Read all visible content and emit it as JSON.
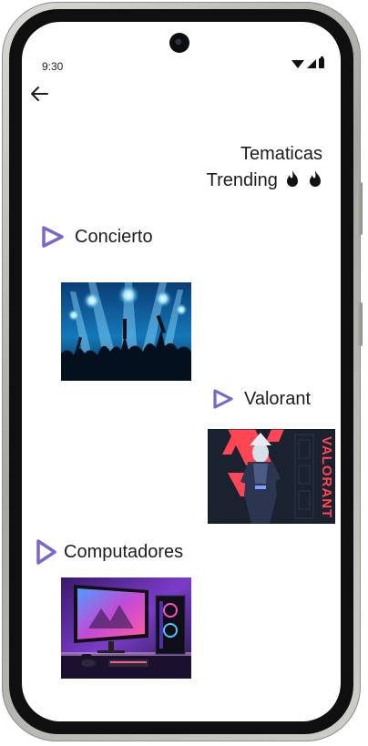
{
  "status_bar": {
    "time": "9:30",
    "icons": [
      "wifi-icon",
      "signal-icon",
      "battery-icon"
    ]
  },
  "header": {
    "back_icon": "arrow-left-icon",
    "title_line1": "Tematicas",
    "title_line2": "Trending",
    "title_icons": [
      "fire-icon",
      "fire-icon"
    ]
  },
  "topics": [
    {
      "label": "Concierto",
      "image": "concert-crowd-stage-lights-image"
    },
    {
      "label": "Valorant",
      "image": "valorant-agent-poster-image"
    },
    {
      "label": "Computadores",
      "image": "gaming-pc-desk-setup-image"
    }
  ],
  "colors": {
    "accent": "#7b66c9",
    "text": "#1c1c1c",
    "background": "#ffffff",
    "valorant_red": "#ff4655"
  }
}
